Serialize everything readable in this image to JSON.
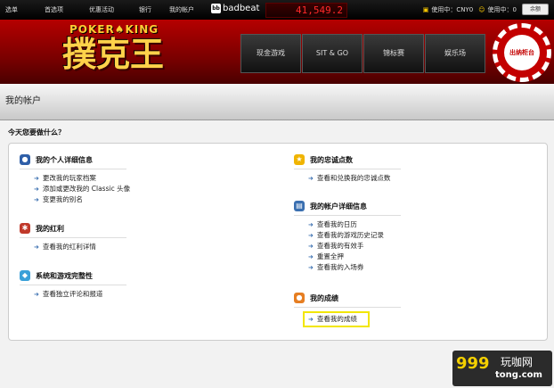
{
  "topbar": {
    "menu": [
      "选单",
      "首选项",
      "优惠活动",
      "银行",
      "我的帐户"
    ],
    "brand": "badbeat",
    "brand_badge": "bb",
    "jackpot": "41,549.2",
    "using_label": "使用中：CNY0",
    "using_label2": "使用中：0",
    "balance_button": "余额"
  },
  "banner": {
    "logo_top": "POKER♠KING",
    "logo_main": "撲克王",
    "nav": [
      "现金游戏",
      "SIT & GO",
      "锦标赛",
      "娱乐场"
    ],
    "cashier": "出纳柜台"
  },
  "page": {
    "title": "我的帐户",
    "question": "今天您要做什么？"
  },
  "sections": [
    {
      "title": "我的个人详细信息",
      "icon_name": "person-icon",
      "color": "#2f5fa8",
      "links": [
        "更改我的玩家档案",
        "添加或更改我的 Classic 头像",
        "变更我的别名"
      ]
    },
    {
      "title": "我的红利",
      "icon_name": "gift-icon",
      "color": "#c0392b",
      "links": [
        "查看我的红利详情"
      ]
    },
    {
      "title": "系统和游戏完整性",
      "icon_name": "shield-icon",
      "color": "#3aa0d8",
      "links": [
        "查看独立评论和报道"
      ]
    },
    {
      "title": "我的忠诚点数",
      "icon_name": "star-icon",
      "color": "#f0b400",
      "links": [
        "查看和兑换我的忠诚点数"
      ]
    },
    {
      "title": "我的帐户详细信息",
      "icon_name": "account-icon",
      "color": "#3a6fb0",
      "links": [
        "查看我的日历",
        "查看我的游戏历史记录",
        "查看我的有效手",
        "重置全押",
        "查看我的入场券"
      ]
    },
    {
      "title": "我的成绩",
      "icon_name": "trophy-icon",
      "color": "#e67e22",
      "links": [
        "查看我的成绩"
      ]
    }
  ],
  "watermark": {
    "number": "999",
    "chinese": "玩咖网",
    "domain": "tong.com"
  }
}
